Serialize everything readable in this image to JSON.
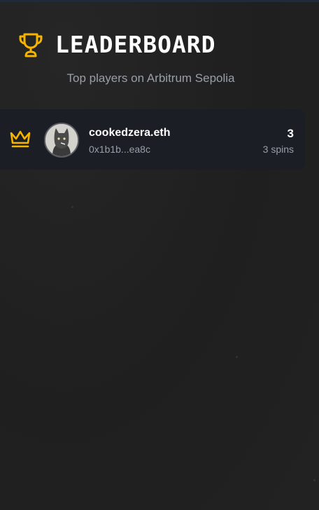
{
  "header": {
    "title": "LEADERBOARD",
    "subtitle": "Top players on Arbitrum Sepolia",
    "icon": "trophy-icon"
  },
  "leaderboard": {
    "entries": [
      {
        "rank_icon": "crown-icon",
        "name": "cookedzera.eth",
        "address": "0x1b1b...ea8c",
        "score": "3",
        "spins": "3 spins"
      }
    ]
  },
  "colors": {
    "accent": "#f5b400",
    "background": "#1f1f20",
    "row_background": "#1b1e25",
    "muted_text": "#9a9ea6"
  }
}
